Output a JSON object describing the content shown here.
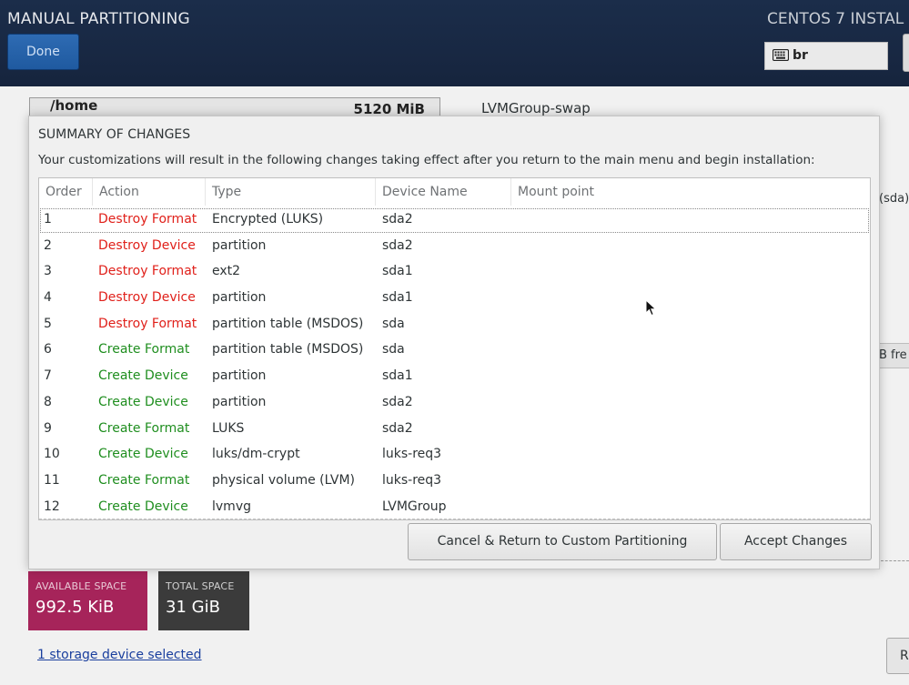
{
  "header": {
    "title": "MANUAL PARTITIONING",
    "done_label": "Done",
    "product": "CENTOS 7 INSTAL",
    "keyboard_layout": "br"
  },
  "background": {
    "mount_name": "/home",
    "mount_size": "5120 MiB",
    "volume_group": "LVMGroup-swap",
    "sda_fragment": "(sda)",
    "free_fragment": "B fre",
    "available_space_label": "AVAILABLE SPACE",
    "available_space_value": "992.5 KiB",
    "total_space_label": "TOTAL SPACE",
    "total_space_value": "31 GiB",
    "storage_link": "1 storage device selected",
    "bottom_button_fragment": "R"
  },
  "dialog": {
    "title": "SUMMARY OF CHANGES",
    "description": "Your customizations will result in the following changes taking effect after you return to the main menu and begin installation:",
    "columns": [
      "Order",
      "Action",
      "Type",
      "Device Name",
      "Mount point"
    ],
    "rows": [
      {
        "order": "1",
        "action": "Destroy Format",
        "kind": "destroy",
        "type": "Encrypted (LUKS)",
        "device": "sda2",
        "mount": ""
      },
      {
        "order": "2",
        "action": "Destroy Device",
        "kind": "destroy",
        "type": "partition",
        "device": "sda2",
        "mount": ""
      },
      {
        "order": "3",
        "action": "Destroy Format",
        "kind": "destroy",
        "type": "ext2",
        "device": "sda1",
        "mount": ""
      },
      {
        "order": "4",
        "action": "Destroy Device",
        "kind": "destroy",
        "type": "partition",
        "device": "sda1",
        "mount": ""
      },
      {
        "order": "5",
        "action": "Destroy Format",
        "kind": "destroy",
        "type": "partition table (MSDOS)",
        "device": "sda",
        "mount": ""
      },
      {
        "order": "6",
        "action": "Create Format",
        "kind": "create",
        "type": "partition table (MSDOS)",
        "device": "sda",
        "mount": ""
      },
      {
        "order": "7",
        "action": "Create Device",
        "kind": "create",
        "type": "partition",
        "device": "sda1",
        "mount": ""
      },
      {
        "order": "8",
        "action": "Create Device",
        "kind": "create",
        "type": "partition",
        "device": "sda2",
        "mount": ""
      },
      {
        "order": "9",
        "action": "Create Format",
        "kind": "create",
        "type": "LUKS",
        "device": "sda2",
        "mount": ""
      },
      {
        "order": "10",
        "action": "Create Device",
        "kind": "create",
        "type": "luks/dm-crypt",
        "device": "luks-req3",
        "mount": ""
      },
      {
        "order": "11",
        "action": "Create Format",
        "kind": "create",
        "type": "physical volume (LVM)",
        "device": "luks-req3",
        "mount": ""
      },
      {
        "order": "12",
        "action": "Create Device",
        "kind": "create",
        "type": "lvmvg",
        "device": "LVMGroup",
        "mount": ""
      }
    ],
    "selected_row": "1",
    "cancel_label": "Cancel & Return to Custom Partitioning",
    "accept_label": "Accept Changes"
  },
  "colors": {
    "header_bg": "#182843",
    "destroy": "#e0201a",
    "create": "#1f8e1f",
    "available_space": "#a6245a",
    "total_space": "#3b3b3b",
    "done_button": "#2663aa"
  },
  "icons": {
    "keyboard": "keyboard-icon",
    "cursor": "mouse-pointer-icon"
  }
}
